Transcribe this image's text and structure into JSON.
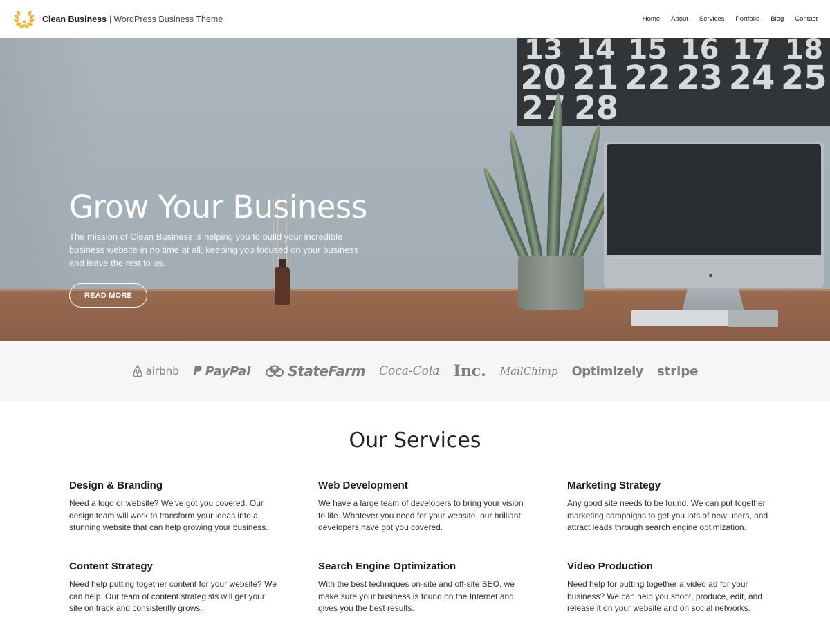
{
  "header": {
    "site_title": "Clean Business",
    "separator": "|",
    "tagline": "WordPress Business Theme",
    "nav": [
      "Home",
      "About",
      "Services",
      "Portfolio",
      "Blog",
      "Contact"
    ]
  },
  "hero": {
    "calendar_rows": [
      [
        "13",
        "14",
        "15",
        "16",
        "17",
        "18"
      ],
      [
        "20",
        "21",
        "22",
        "23",
        "24",
        "25"
      ],
      [
        "27",
        "28"
      ]
    ],
    "title": "Grow Your Business",
    "text": "The mission of Clean Business is helping you to build your incredible business website in no time at all, keeping you focused on your business and leave the rest to us.",
    "button_label": "READ MORE"
  },
  "logos": [
    "airbnb",
    "PayPal",
    "StateFarm",
    "Coca-Cola",
    "Inc.",
    "MailChimp",
    "Optimizely",
    "stripe"
  ],
  "services": {
    "title": "Our Services",
    "items": [
      {
        "title": "Design & Branding",
        "text": "Need a logo or website? We've got you covered. Our design team will work to transform your ideas into a stunning website that can help growing your business."
      },
      {
        "title": "Web Development",
        "text": "We have a large team of developers to bring your vision to life. Whatever you need for your website, our brilliant developers have got you covered."
      },
      {
        "title": "Marketing Strategy",
        "text": "Any good site needs to be found. We can put together marketing campaigns to get you lots of new users, and attract leads through search engine optimization."
      },
      {
        "title": "Content Strategy",
        "text": "Need help putting together content for your website? We can help. Our team of content strategists will get your site on track and consistently grows."
      },
      {
        "title": "Search Engine Optimization",
        "text": "With the best techniques on-site and off-site SEO, we make sure your business is found on the Internet and gives you the best results."
      },
      {
        "title": "Video Production",
        "text": "Need help for putting together a video ad for your business? We can help you shoot, produce, edit, and release it on your website and on social networks."
      }
    ]
  },
  "colors": {
    "logo_gold": "#f0b63b",
    "logo_strip_bg": "#f6f6f6",
    "hero_sky": "#b4bec5",
    "desk": "#9a6546"
  }
}
